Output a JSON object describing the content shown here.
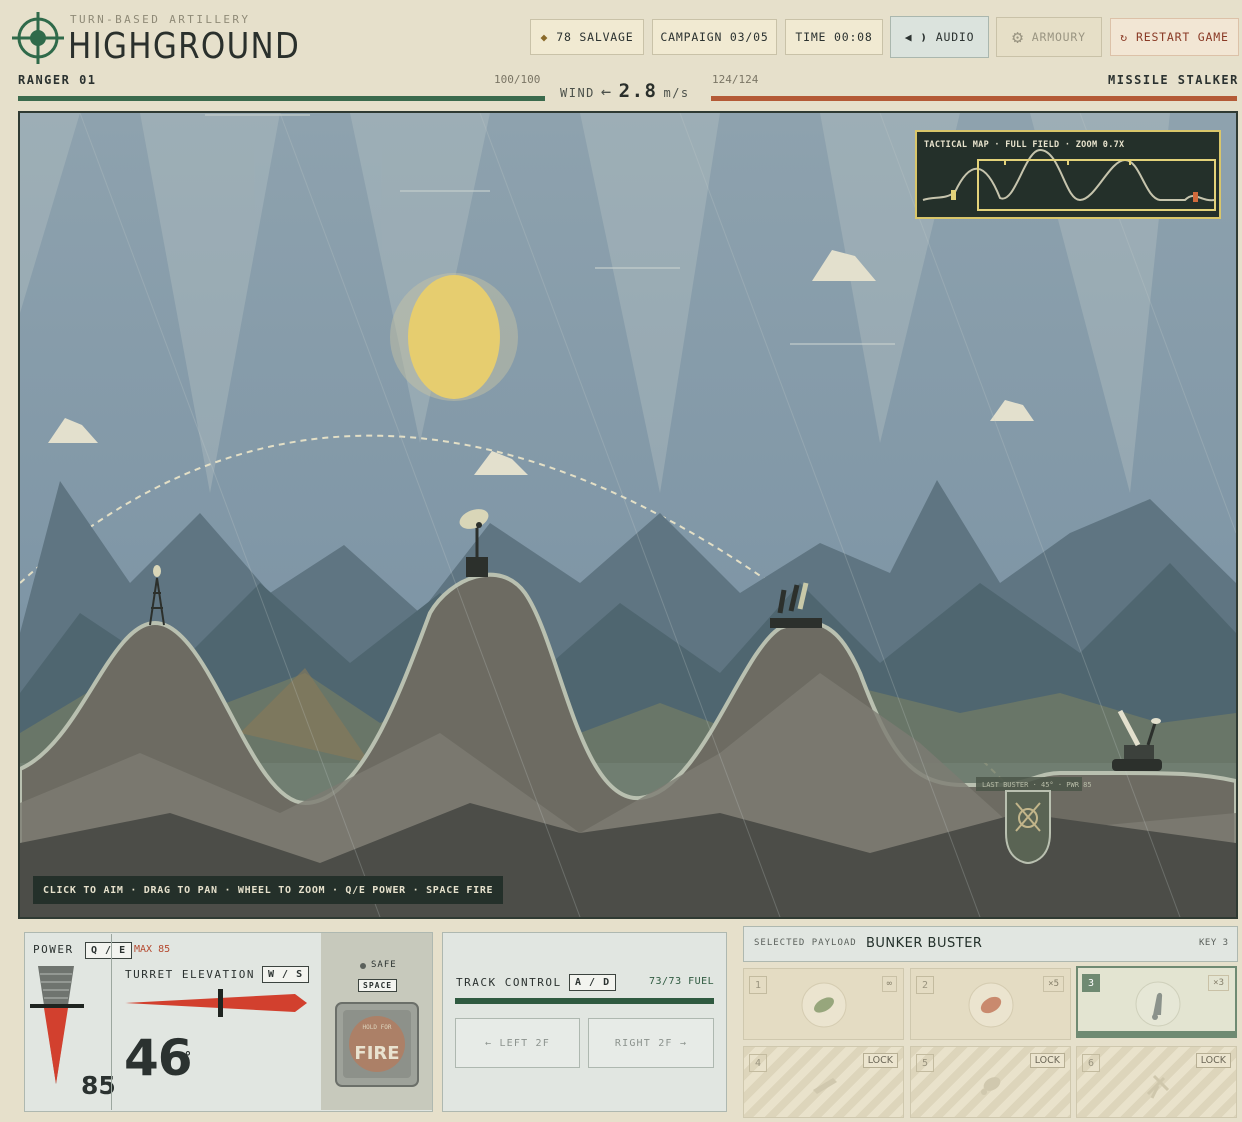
{
  "header": {
    "subtitle": "TURN-BASED ARTILLERY",
    "title": "HIGHGROUND",
    "salvage": "78 SALVAGE",
    "campaign": "CAMPAIGN 03/05",
    "time": "TIME 00:08",
    "audio": "AUDIO",
    "armoury": "ARMOURY",
    "restart": "RESTART GAME"
  },
  "players": {
    "p1": {
      "name": "RANGER 01",
      "hp": "100/100",
      "hp_fraction": 1.0,
      "color": "#3a6a4c"
    },
    "p2": {
      "name": "MISSILE STALKER",
      "hp": "124/124",
      "hp_fraction": 1.0,
      "color": "#b45a36"
    }
  },
  "wind": {
    "label": "WIND",
    "arrow": "←",
    "value": "2.8",
    "unit": "m/s"
  },
  "field": {
    "minimap_label": "TACTICAL MAP · FULL FIELD · ZOOM 0.7X",
    "target_label": "LAST BUSTER · 45° · PWR 85",
    "hint": "CLICK TO AIM · DRAG TO PAN · WHEEL TO ZOOM · Q/E POWER · SPACE FIRE"
  },
  "power": {
    "label": "POWER",
    "key": "Q / E",
    "max": "MAX 85",
    "value": "85"
  },
  "elevation": {
    "label": "TURRET ELEVATION",
    "key": "W / S",
    "value": "46",
    "unit": "°"
  },
  "fire": {
    "safe_label": "SAFE",
    "key": "SPACE",
    "button_label": "FIRE",
    "button_sub": "HOLD FOR"
  },
  "track": {
    "label": "TRACK CONTROL",
    "key": "A / D",
    "fuel": "73/73 FUEL",
    "fuel_fraction": 1.0,
    "left": "← LEFT 2F",
    "right": "RIGHT 2F →"
  },
  "payload": {
    "label": "SELECTED PAYLOAD",
    "name": "BUNKER BUSTER",
    "key": "KEY 3",
    "slots": [
      {
        "num": "1",
        "count": "∞",
        "icon": "shell-icon",
        "locked": false
      },
      {
        "num": "2",
        "count": "×5",
        "icon": "heavy-shell-icon",
        "locked": false
      },
      {
        "num": "3",
        "count": "×3",
        "icon": "bunker-buster-icon",
        "locked": false,
        "selected": true
      },
      {
        "num": "4",
        "lock": "LOCK",
        "icon": "locked-missile-icon",
        "locked": true
      },
      {
        "num": "5",
        "lock": "LOCK",
        "icon": "locked-cluster-icon",
        "locked": true
      },
      {
        "num": "6",
        "lock": "LOCK",
        "icon": "locked-drone-icon",
        "locked": true
      }
    ]
  }
}
